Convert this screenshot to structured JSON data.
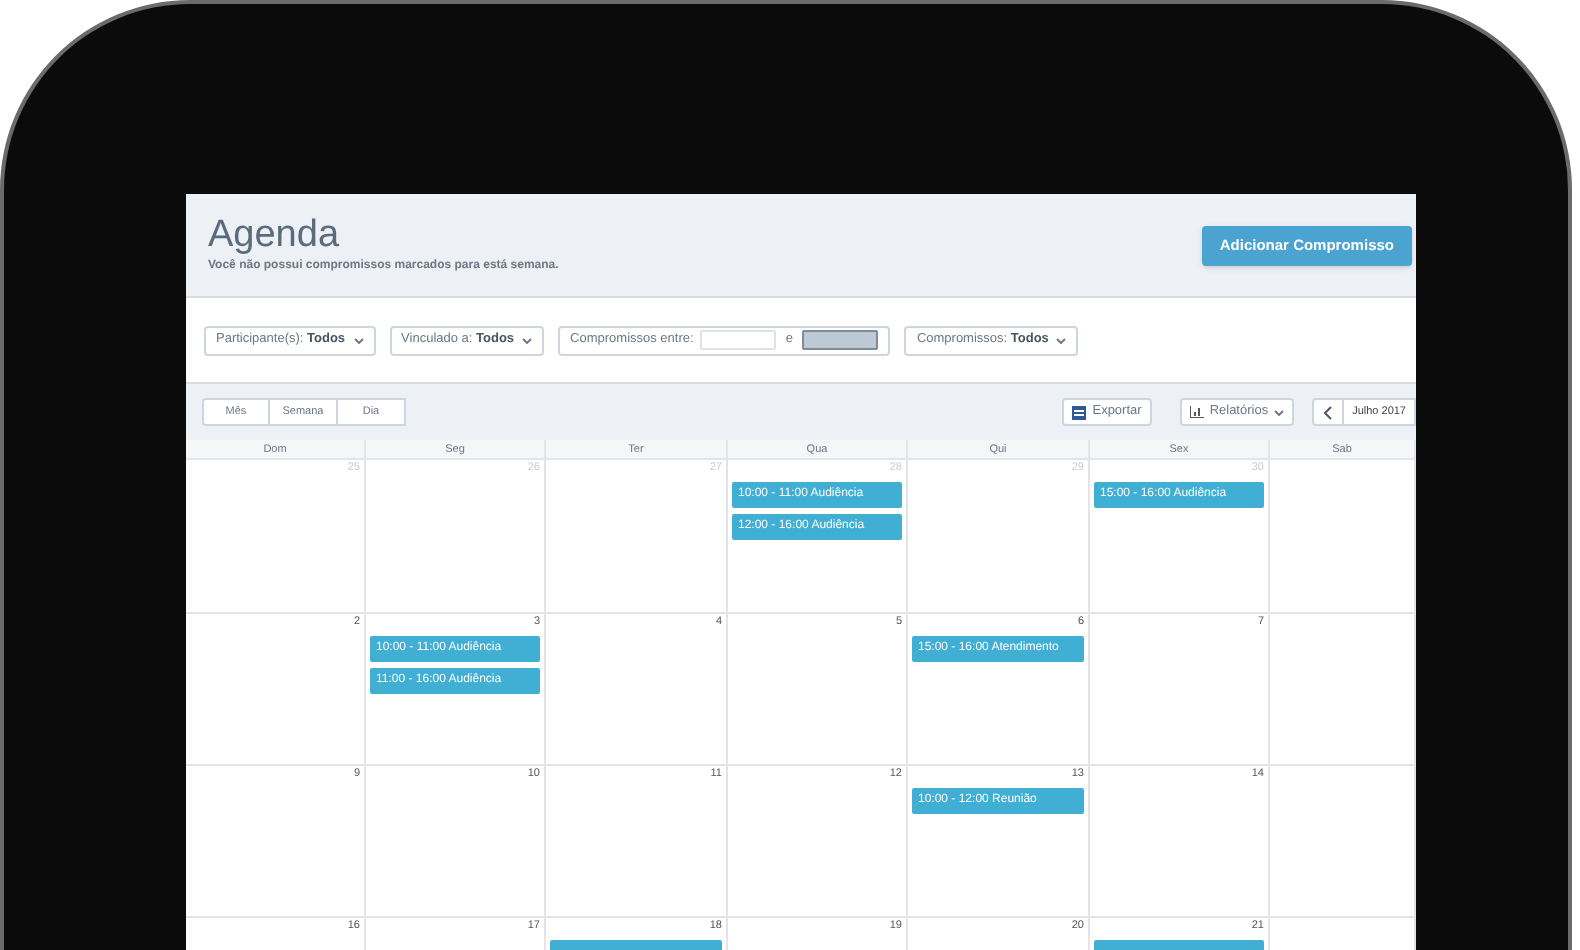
{
  "header": {
    "title": "Agenda",
    "subtitle": "Você não possui compromissos marcados para está semana.",
    "add_button": "Adicionar Compromisso"
  },
  "filters": [
    {
      "kind": "dropdown",
      "label": "Participante(s):",
      "value": "Todos"
    },
    {
      "kind": "dropdown",
      "label": "Vinculado a:",
      "value": "Todos"
    },
    {
      "kind": "range",
      "label": "Compromissos entre:",
      "separator": "e"
    },
    {
      "kind": "dropdown",
      "label": "Compromissos:",
      "value": "Todos"
    }
  ],
  "view_tabs": [
    {
      "label": "Mês",
      "selected": false
    },
    {
      "label": "Semana",
      "selected": false
    },
    {
      "label": "Dia",
      "selected": false
    }
  ],
  "export_button": "Exportar",
  "reports_button": "Relatórios",
  "month_label": "Julho 2017",
  "weekdays": [
    "Dom",
    "Seg",
    "Ter",
    "Qua",
    "Qui",
    "Sex",
    "Sab"
  ],
  "weeks": [
    [
      {
        "day": "25",
        "other_month": true
      },
      {
        "day": "26",
        "other_month": true
      },
      {
        "day": "27",
        "other_month": true
      },
      {
        "day": "28",
        "other_month": true,
        "events": [
          {
            "kind": "full",
            "label": "10:00 - 11:00 Audiência"
          },
          {
            "kind": "full",
            "label": "12:00 - 16:00 Audiência"
          }
        ]
      },
      {
        "day": "29",
        "other_month": true
      },
      {
        "day": "30",
        "other_month": true,
        "events": [
          {
            "kind": "full",
            "label": "15:00 - 16:00 Audiência"
          }
        ]
      }
    ],
    [
      {
        "day": "2",
        "other_month": false
      },
      {
        "day": "3",
        "other_month": false,
        "events": [
          {
            "kind": "full",
            "label": "10:00 - 11:00 Audiência"
          },
          {
            "kind": "full",
            "label": "11:00 - 16:00 Audiência"
          }
        ]
      },
      {
        "day": "4",
        "other_month": false
      },
      {
        "day": "5",
        "other_month": false
      },
      {
        "day": "6",
        "other_month": false,
        "events": [
          {
            "kind": "full",
            "label": "15:00 - 16:00 Atendimento"
          }
        ]
      },
      {
        "day": "7",
        "other_month": false
      }
    ],
    [
      {
        "day": "9",
        "other_month": false
      },
      {
        "day": "10",
        "other_month": false
      },
      {
        "day": "11",
        "other_month": false
      },
      {
        "day": "12",
        "other_month": false
      },
      {
        "day": "13",
        "other_month": false,
        "events": [
          {
            "kind": "full",
            "label": "10:00 - 12:00 Reunião"
          }
        ]
      },
      {
        "day": "14",
        "other_month": false
      }
    ],
    [
      {
        "day": "16",
        "other_month": false
      },
      {
        "day": "17",
        "other_month": false
      },
      {
        "day": "18",
        "other_month": false,
        "events": [
          {
            "kind": "clipped"
          }
        ]
      },
      {
        "day": "19",
        "other_month": false
      },
      {
        "day": "20",
        "other_month": false
      },
      {
        "day": "21",
        "other_month": false,
        "events": [
          {
            "kind": "clipped"
          }
        ]
      }
    ]
  ]
}
